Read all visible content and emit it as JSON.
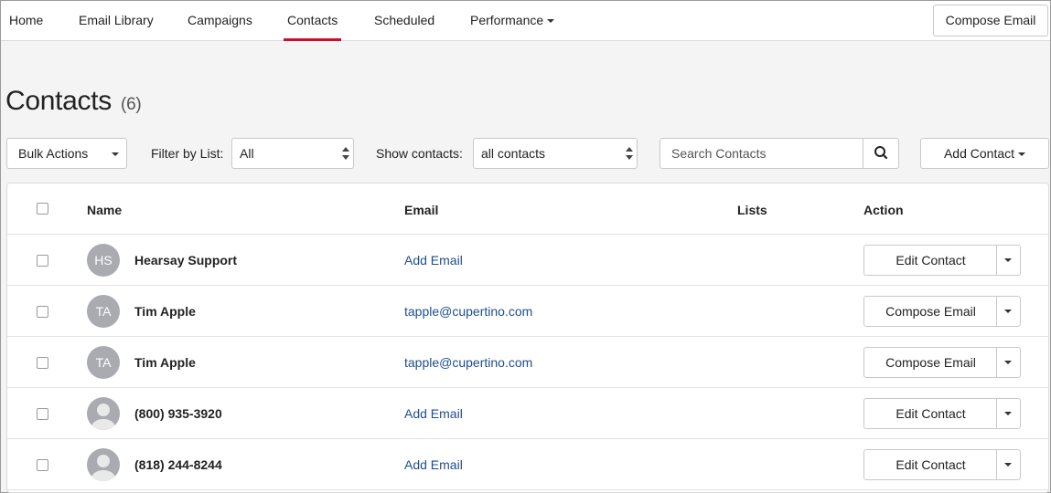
{
  "nav": {
    "items": [
      {
        "label": "Home"
      },
      {
        "label": "Email Library"
      },
      {
        "label": "Campaigns"
      },
      {
        "label": "Contacts",
        "active": true
      },
      {
        "label": "Scheduled"
      },
      {
        "label": "Performance",
        "dropdown": true
      }
    ],
    "compose_label": "Compose Email"
  },
  "page": {
    "title": "Contacts",
    "count": "(6)"
  },
  "toolbar": {
    "bulk_actions_label": "Bulk Actions",
    "filter_label": "Filter by List:",
    "filter_value": "All",
    "show_label": "Show contacts:",
    "show_value": "all contacts",
    "search_placeholder": "Search Contacts",
    "add_contact_label": "Add Contact"
  },
  "table": {
    "columns": {
      "name": "Name",
      "email": "Email",
      "lists": "Lists",
      "action": "Action"
    },
    "rows": [
      {
        "initials": "HS",
        "name": "Hearsay Support",
        "email": "Add Email",
        "lists": "",
        "action": "Edit Contact"
      },
      {
        "initials": "TA",
        "name": "Tim Apple",
        "email": "tapple@cupertino.com",
        "lists": "",
        "action": "Compose Email"
      },
      {
        "initials": "TA",
        "name": "Tim Apple",
        "email": "tapple@cupertino.com",
        "lists": "",
        "action": "Compose Email"
      },
      {
        "initials": "",
        "name": "(800) 935-3920",
        "email": "Add Email",
        "lists": "",
        "action": "Edit Contact"
      },
      {
        "initials": "",
        "name": "(818) 244-8244",
        "email": "Add Email",
        "lists": "",
        "action": "Edit Contact"
      }
    ]
  },
  "colors": {
    "accent": "#c8102e",
    "link": "#1f4e8c",
    "avatar": "#a9abb1",
    "page_bg": "#f4f4f5"
  },
  "icons": {
    "search": "search-icon",
    "caret": "caret-down-icon",
    "select_arrows": "select-arrows-icon",
    "person": "person-placeholder-icon"
  }
}
